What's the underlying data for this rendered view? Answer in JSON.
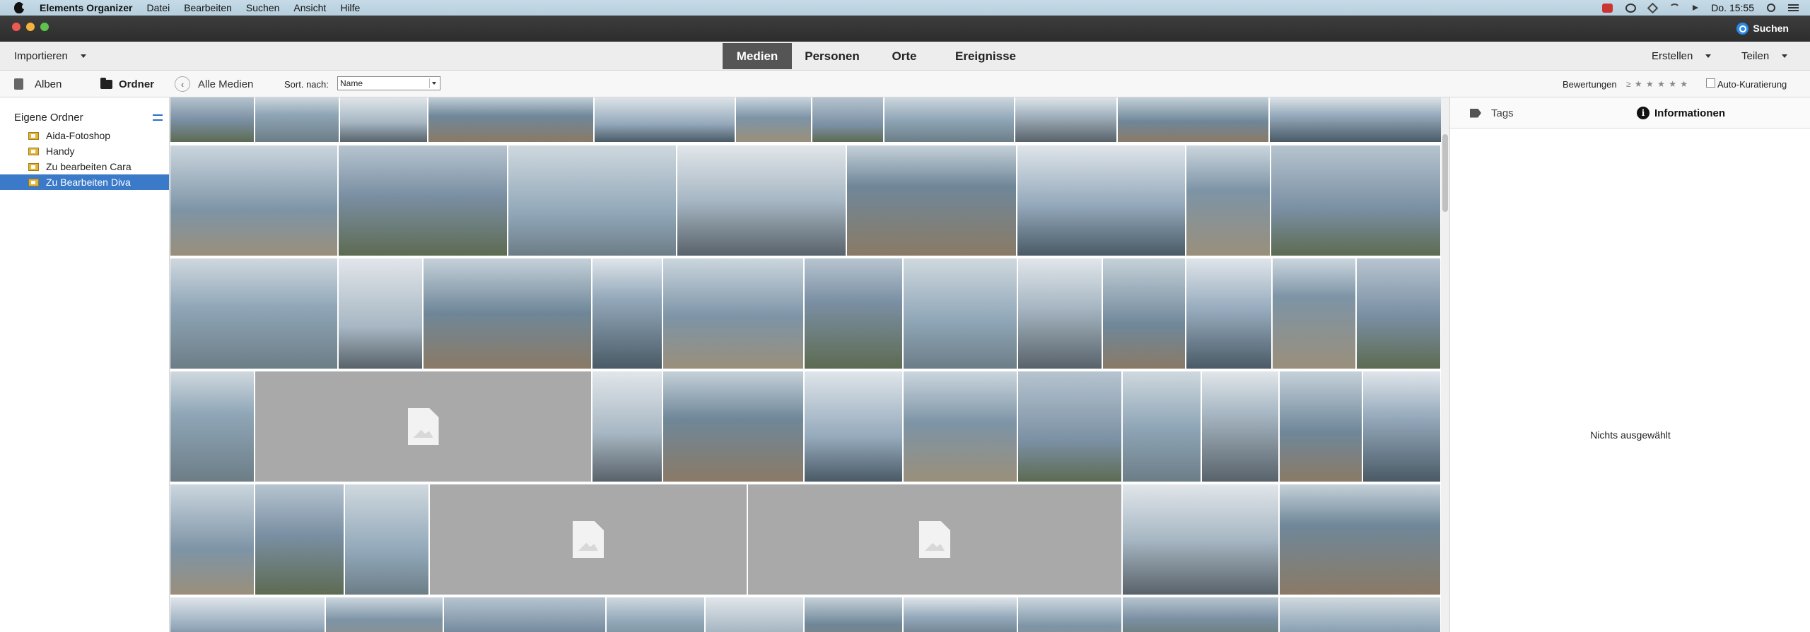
{
  "menubar": {
    "app_name": "Elements Organizer",
    "items": [
      "Datei",
      "Bearbeiten",
      "Suchen",
      "Ansicht",
      "Hilfe"
    ],
    "clock": "Do. 15:55"
  },
  "titlebar": {
    "search_label": "Suchen"
  },
  "toolbar": {
    "import_label": "Importieren",
    "tabs": [
      "Medien",
      "Personen",
      "Orte",
      "Ereignisse"
    ],
    "active_tab": "Medien",
    "create_label": "Erstellen",
    "share_label": "Teilen"
  },
  "subbar": {
    "albums_label": "Alben",
    "folders_label": "Ordner",
    "back_label": "Alle Medien",
    "sort_label": "Sort. nach:",
    "sort_value": "Name",
    "ratings_label": "Bewertungen",
    "ratings_filter": "≥ ★ ★ ★ ★ ★",
    "auto_curation_label": "Auto-Kuratierung",
    "auto_curation_checked": false
  },
  "leftpanel": {
    "heading": "Eigene Ordner",
    "folders": [
      {
        "label": "Aida-Fotoshop",
        "selected": false
      },
      {
        "label": "Handy",
        "selected": false
      },
      {
        "label": "Zu bearbeiten Cara",
        "selected": false
      },
      {
        "label": "Zu Bearbeiten Diva",
        "selected": true
      }
    ]
  },
  "rightpanel": {
    "tabs": [
      "Tags",
      "Informationen"
    ],
    "active_tab": "Informationen",
    "empty_text": "Nichts ausgewählt"
  },
  "colors": {
    "selection": "#3a7ac9",
    "active_tab_bg": "#555555",
    "missing_tile": "#a9a9a9",
    "accent": "#2b8ae6"
  }
}
